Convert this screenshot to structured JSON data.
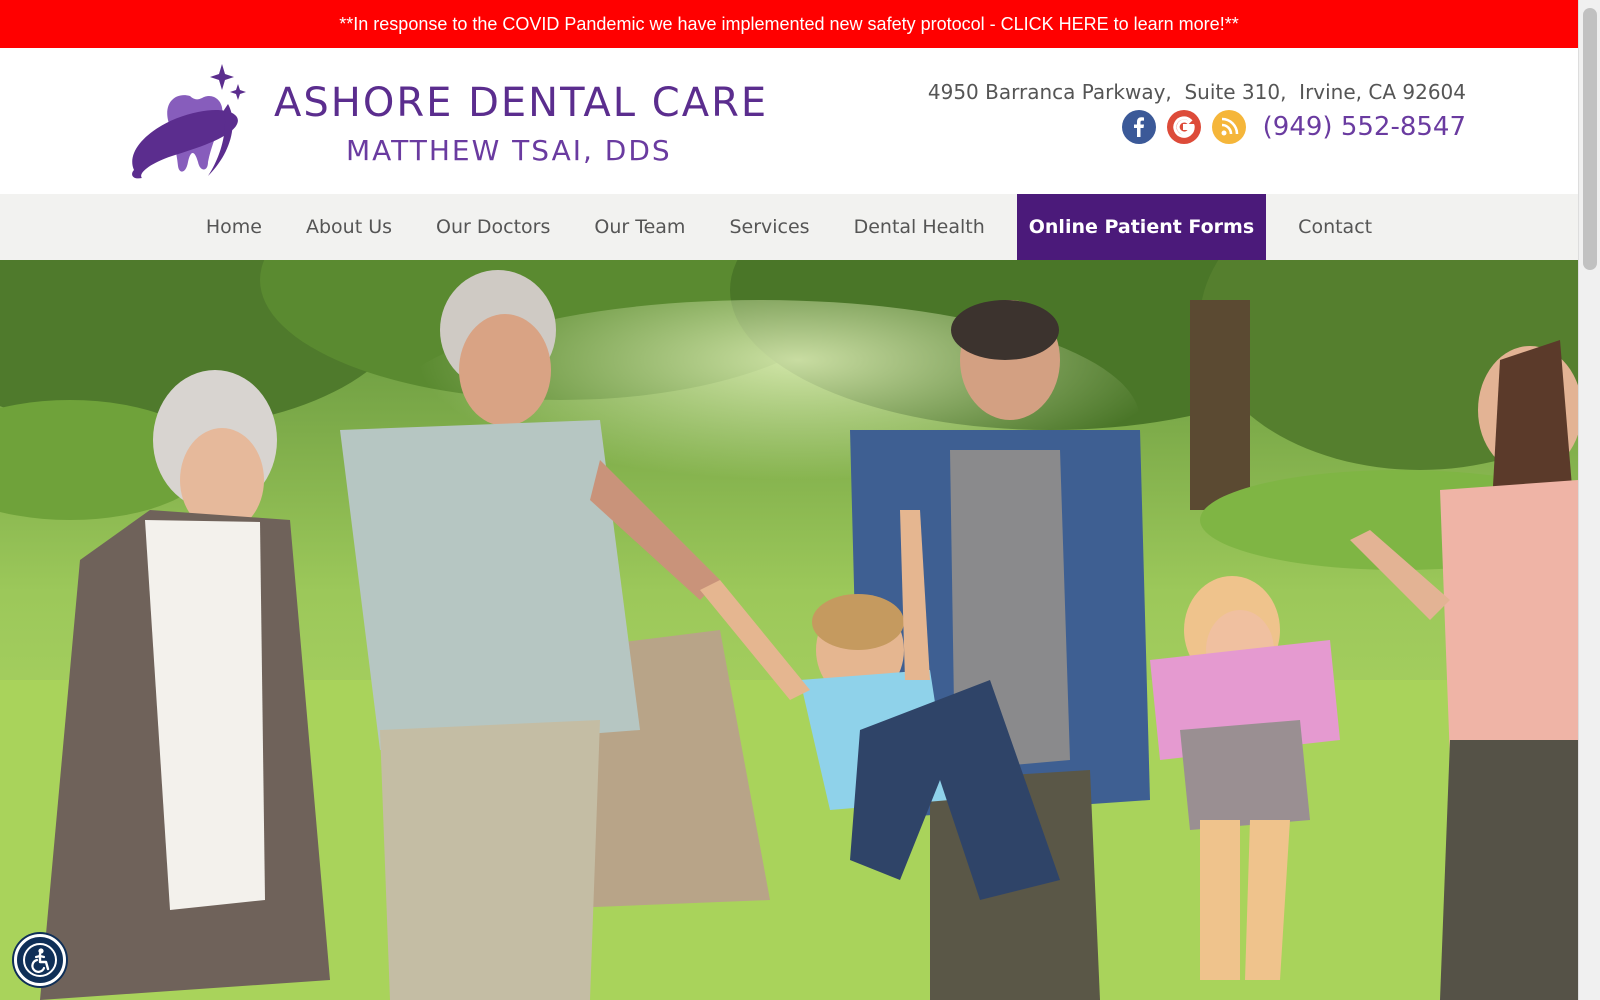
{
  "covid_banner": {
    "text": "**In response to the COVID Pandemic we have implemented new safety protocol - CLICK HERE to learn more!**",
    "background_color": "#ff0000"
  },
  "header": {
    "logo": {
      "title": "ASHORE DENTAL CARE",
      "subtitle": "MATTHEW TSAI, DDS",
      "icon": "tooth-orbit-logo-icon"
    },
    "address": "4950 Barranca Parkway,  Suite 310,  Irvine, CA 92604",
    "social": [
      {
        "name": "facebook",
        "icon": "facebook-icon",
        "color": "#3b5998"
      },
      {
        "name": "google",
        "icon": "google-icon",
        "color": "#dd4b39"
      },
      {
        "name": "rss",
        "icon": "rss-icon",
        "color": "#f5b63a"
      }
    ],
    "phone": "(949) 552-8547"
  },
  "nav": {
    "items": [
      {
        "label": "Home",
        "active": false
      },
      {
        "label": "About Us",
        "active": false
      },
      {
        "label": "Our Doctors",
        "active": false
      },
      {
        "label": "Our Team",
        "active": false
      },
      {
        "label": "Services",
        "active": false
      },
      {
        "label": "Dental Health",
        "active": false
      },
      {
        "label": "Online Patient Forms",
        "active": true
      },
      {
        "label": "Contact",
        "active": false
      }
    ],
    "active_color": "#4b1a7a"
  },
  "hero": {
    "image": "family-in-park-photo"
  },
  "accessibility": {
    "icon": "accessibility-icon"
  },
  "colors": {
    "brand_purple": "#5b2d8e",
    "nav_background": "#f2f2f0"
  }
}
